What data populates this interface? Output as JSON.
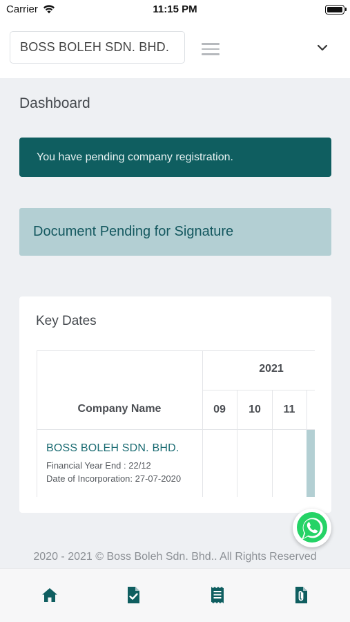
{
  "status_bar": {
    "carrier": "Carrier",
    "time": "11:15 PM"
  },
  "header": {
    "company_selected": "BOSS BOLEH SDN. BHD."
  },
  "page": {
    "title": "Dashboard"
  },
  "alert": {
    "message": "You have pending company registration."
  },
  "document_pending": {
    "label": "Document Pending for Signature"
  },
  "key_dates": {
    "title": "Key Dates",
    "column_company": "Company Name",
    "year": "2021",
    "months": [
      "09",
      "10",
      "11"
    ],
    "rows": [
      {
        "company": "BOSS BOLEH SDN. BHD.",
        "financial_year_end": "Financial Year End : 22/12",
        "date_of_incorporation": "Date of Incorporation: 27-07-2020"
      }
    ]
  },
  "footer": {
    "text": "2020 - 2021 © Boss Boleh Sdn. Bhd.. All Rights Reserved"
  },
  "tabs": [
    {
      "icon": "home-icon"
    },
    {
      "icon": "document-check-icon"
    },
    {
      "icon": "receipt-icon"
    },
    {
      "icon": "attachment-file-icon"
    }
  ],
  "colors": {
    "primary": "#0f5e60",
    "accent_light": "#b3cfd3",
    "background": "#eef0f3",
    "whatsapp": "#25d366"
  }
}
